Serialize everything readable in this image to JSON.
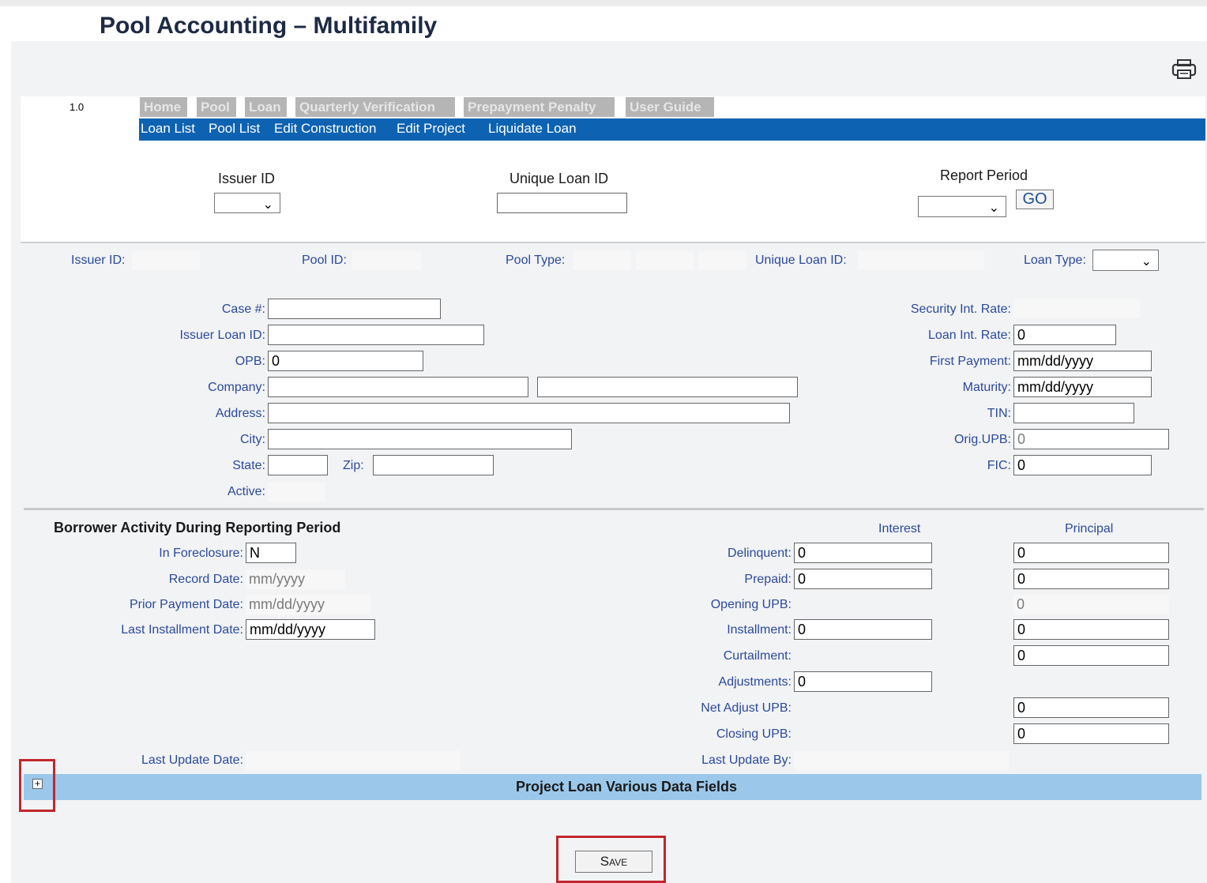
{
  "page": {
    "title": "Pool Accounting – Multifamily",
    "version": "1.0"
  },
  "icons": {
    "print": "printer-icon",
    "expand": "plus-box-icon",
    "dropdown": "chevron-down-icon"
  },
  "colors": {
    "nav_blue": "#0d62b1",
    "section_bar": "#9bc8ea",
    "label_blue": "#2b4a9b",
    "highlight_red": "#c1272d"
  },
  "tabs": [
    "Home",
    "Pool",
    "Loan",
    "Quarterly Verification",
    "Prepayment Penalty",
    "User Guide"
  ],
  "subnav": [
    "Loan List",
    "Pool List",
    "Edit Construction",
    "Edit Project",
    "Liquidate Loan"
  ],
  "search": {
    "issuer_id_label": "Issuer ID",
    "unique_loan_id_label": "Unique Loan ID",
    "report_period_label": "Report Period",
    "go_label": "GO"
  },
  "summary": {
    "issuer_id": "Issuer ID:",
    "pool_id": "Pool ID:",
    "pool_type": "Pool Type:",
    "unique_loan_id": "Unique Loan ID:",
    "loan_type": "Loan Type:"
  },
  "loan": {
    "case_label": "Case #:",
    "issuer_loan_id_label": "Issuer Loan ID:",
    "opb_label": "OPB:",
    "opb_value": "0",
    "company_label": "Company:",
    "address_label": "Address:",
    "city_label": "City:",
    "state_label": "State:",
    "zip_label": "Zip:",
    "active_label": "Active:",
    "security_rate_label": "Security Int. Rate:",
    "loan_rate_label": "Loan Int. Rate:",
    "loan_rate_value": "0",
    "first_payment_label": "First Payment:",
    "first_payment_value": "mm/dd/yyyy",
    "maturity_label": "Maturity:",
    "maturity_value": "mm/dd/yyyy",
    "tin_label": "TIN:",
    "orig_upb_label": "Orig.UPB:",
    "orig_upb_value": "0",
    "fic_label": "FIC:",
    "fic_value": "0"
  },
  "activity": {
    "title": "Borrower Activity During Reporting Period",
    "in_foreclosure_label": "In Foreclosure:",
    "in_foreclosure_value": "N",
    "record_date_label": "Record Date:",
    "record_date_value": "mm/yyyy",
    "prior_payment_label": "Prior Payment Date:",
    "prior_payment_value": "mm/dd/yyyy",
    "last_installment_label": "Last Installment Date:",
    "last_installment_value": "mm/dd/yyyy",
    "interest_header": "Interest",
    "principal_header": "Principal",
    "rows": {
      "delinquent": {
        "label": "Delinquent:",
        "interest": "0",
        "principal": "0"
      },
      "prepaid": {
        "label": "Prepaid:",
        "interest": "0",
        "principal": "0"
      },
      "opening_upb": {
        "label": "Opening UPB:",
        "principal": "0"
      },
      "installment": {
        "label": "Installment:",
        "interest": "0",
        "principal": "0"
      },
      "curtailment": {
        "label": "Curtailment:",
        "principal": "0"
      },
      "adjustments": {
        "label": "Adjustments:",
        "interest": "0"
      },
      "net_adjust_upb": {
        "label": "Net Adjust UPB:",
        "principal": "0"
      },
      "closing_upb": {
        "label": "Closing UPB:",
        "principal": "0"
      }
    },
    "last_update_date_label": "Last Update Date:",
    "last_update_by_label": "Last Update By:"
  },
  "project_section": {
    "title": "Project Loan Various Data Fields"
  },
  "save_label": "Save"
}
